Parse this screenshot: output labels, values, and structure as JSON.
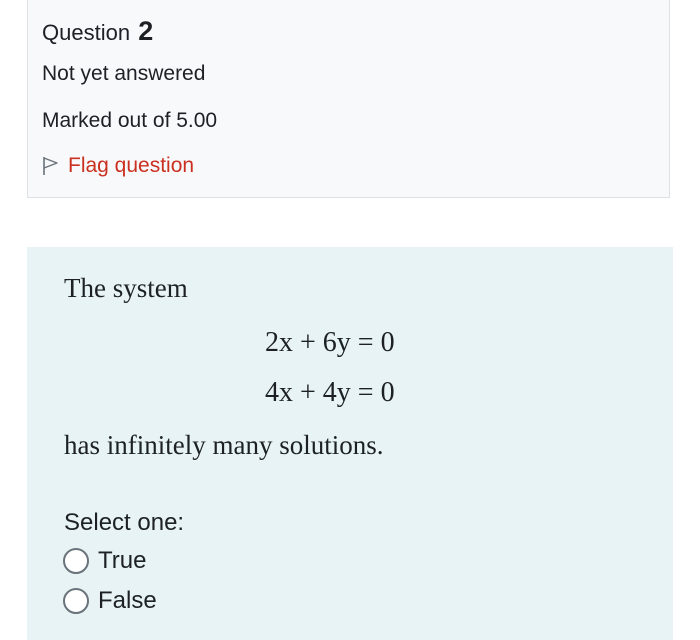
{
  "info": {
    "question_label": "Question",
    "question_number": "2",
    "state": "Not yet answered",
    "grade": "Marked out of 5.00",
    "flag_label": "Flag question",
    "flag_color": "#ca3120"
  },
  "question": {
    "intro": "The system",
    "equations": [
      "2x + 6y = 0",
      "4x + 4y = 0"
    ],
    "conclusion": "has infinitely many solutions.",
    "prompt": "Select one:",
    "options": [
      {
        "label": "True",
        "selected": false
      },
      {
        "label": "False",
        "selected": false
      }
    ],
    "background_color": "#e7f3f5"
  },
  "icons": {
    "flag": "flag-outline-icon"
  }
}
